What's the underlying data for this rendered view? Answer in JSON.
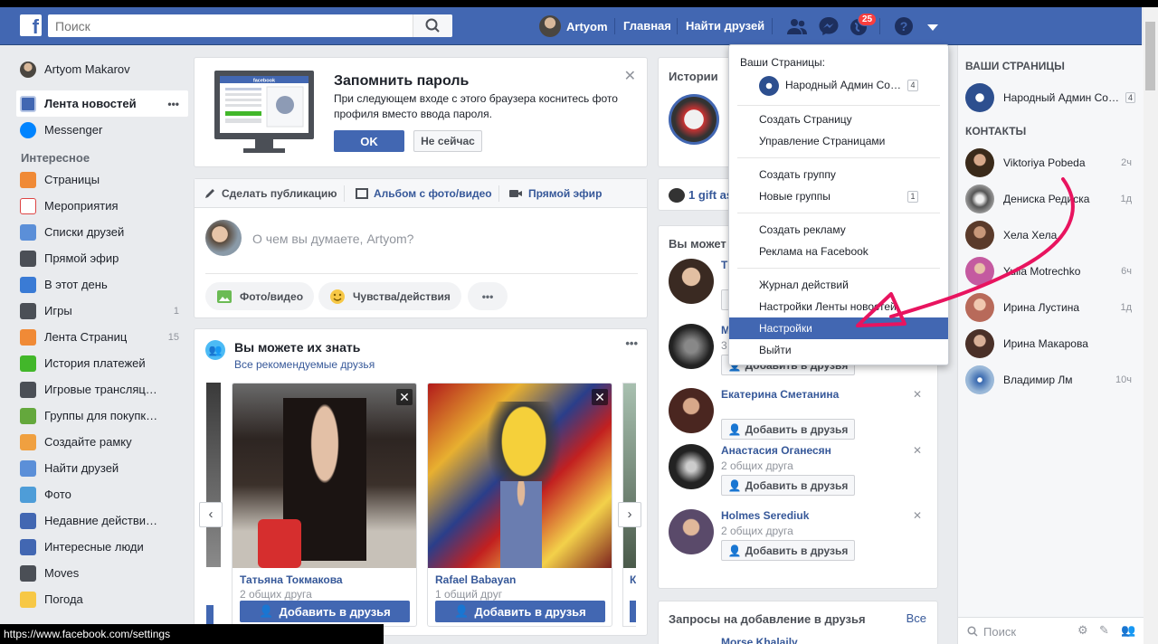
{
  "header": {
    "logo": "f",
    "search_placeholder": "Поиск",
    "user_name": "Artyom",
    "home_label": "Главная",
    "find_friends_label": "Найти друзей",
    "notif_count": "25"
  },
  "leftnav": {
    "user": "Artyom Makarov",
    "news_feed": "Лента новостей",
    "messenger": "Messenger",
    "explore_heading": "Интересное",
    "items": [
      {
        "label": "Страницы",
        "count": ""
      },
      {
        "label": "Мероприятия",
        "count": ""
      },
      {
        "label": "Списки друзей",
        "count": ""
      },
      {
        "label": "Прямой эфир",
        "count": ""
      },
      {
        "label": "В этот день",
        "count": ""
      },
      {
        "label": "Игры",
        "count": "1"
      },
      {
        "label": "Лента Страниц",
        "count": "15"
      },
      {
        "label": "История платежей",
        "count": ""
      },
      {
        "label": "Игровые трансляц…",
        "count": ""
      },
      {
        "label": "Группы для покупк…",
        "count": ""
      },
      {
        "label": "Создайте рамку",
        "count": ""
      },
      {
        "label": "Найти друзей",
        "count": ""
      },
      {
        "label": "Фото",
        "count": ""
      },
      {
        "label": "Недавние действи…",
        "count": ""
      },
      {
        "label": "Интересные люди",
        "count": ""
      },
      {
        "label": "Moves",
        "count": ""
      },
      {
        "label": "Погода",
        "count": ""
      }
    ]
  },
  "remember": {
    "title": "Запомнить пароль",
    "text": "При следующем входе с этого браузера коснитесь фото профиля вместо ввода пароля.",
    "ok_label": "OK",
    "later_label": "Не сейчас",
    "illustration_brand": "facebook"
  },
  "composer": {
    "tab_post": "Сделать публикацию",
    "tab_album": "Альбом с фото/видео",
    "tab_live": "Прямой эфир",
    "placeholder": "О чем вы думаете, Artyom?",
    "photo_video": "Фото/видео",
    "feelings": "Чувства/действия",
    "more": "•••"
  },
  "pymk": {
    "title": "Вы можете их знать",
    "link": "Все рекомендуемые друзья",
    "add_label": "Добавить в друзья",
    "cards": [
      {
        "name": "Татьяна Токмакова",
        "mutual": "2 общих друга"
      },
      {
        "name": "Rafael Babayan",
        "mutual": "1 общий друг"
      }
    ],
    "partial_name": "К"
  },
  "stories": {
    "title": "Истории"
  },
  "gift": {
    "text": "1 gift as"
  },
  "right_pymk": {
    "title": "Вы может",
    "add_label": "Добавить в друзья",
    "items": [
      {
        "name": "T",
        "mutual": ""
      },
      {
        "name": "M",
        "mutual": "3"
      },
      {
        "name": "Екатерина Сметанина",
        "mutual": ""
      },
      {
        "name": "Анастасия Оганесян",
        "mutual": "2 общих друга"
      },
      {
        "name": "Holmes Serediuk",
        "mutual": "2 общих друга"
      }
    ]
  },
  "friend_requests": {
    "title": "Запросы на добавление в друзья",
    "all": "Все",
    "first_name": "Morse Khalaily"
  },
  "dropdown": {
    "your_pages": "Ваши Страницы:",
    "page_name": "Народный Админ Со…",
    "page_count": "4",
    "create_page": "Создать Страницу",
    "manage_pages": "Управление Страницами",
    "create_group": "Создать группу",
    "new_groups": "Новые группы",
    "new_groups_count": "1",
    "create_ad": "Создать рекламу",
    "fb_ads": "Реклама на Facebook",
    "activity_log": "Журнал действий",
    "feed_prefs": "Настройки Ленты новостей",
    "settings": "Настройки",
    "logout": "Выйти"
  },
  "sidebar": {
    "pages_heading": "ВАШИ СТРАНИЦЫ",
    "page_name": "Народный Админ Со…",
    "page_count": "4",
    "contacts_heading": "КОНТАКТЫ",
    "contacts": [
      {
        "name": "Viktoriya Pobeda",
        "time": "2ч"
      },
      {
        "name": "Дениска Редиска",
        "time": "1д"
      },
      {
        "name": "Хела Хела",
        "time": ""
      },
      {
        "name": "Yulia Motrechko",
        "time": "6ч"
      },
      {
        "name": "Ирина Лустина",
        "time": "1д"
      },
      {
        "name": "Ирина Макарова",
        "time": ""
      },
      {
        "name": "Владимир Лм",
        "time": "10ч"
      }
    ],
    "search_placeholder": "Поиск"
  },
  "status_url": "https://www.facebook.com/settings",
  "colors": {
    "brand": "#4267b2",
    "highlight": "#4267b2",
    "annotation": "#e8145f"
  }
}
